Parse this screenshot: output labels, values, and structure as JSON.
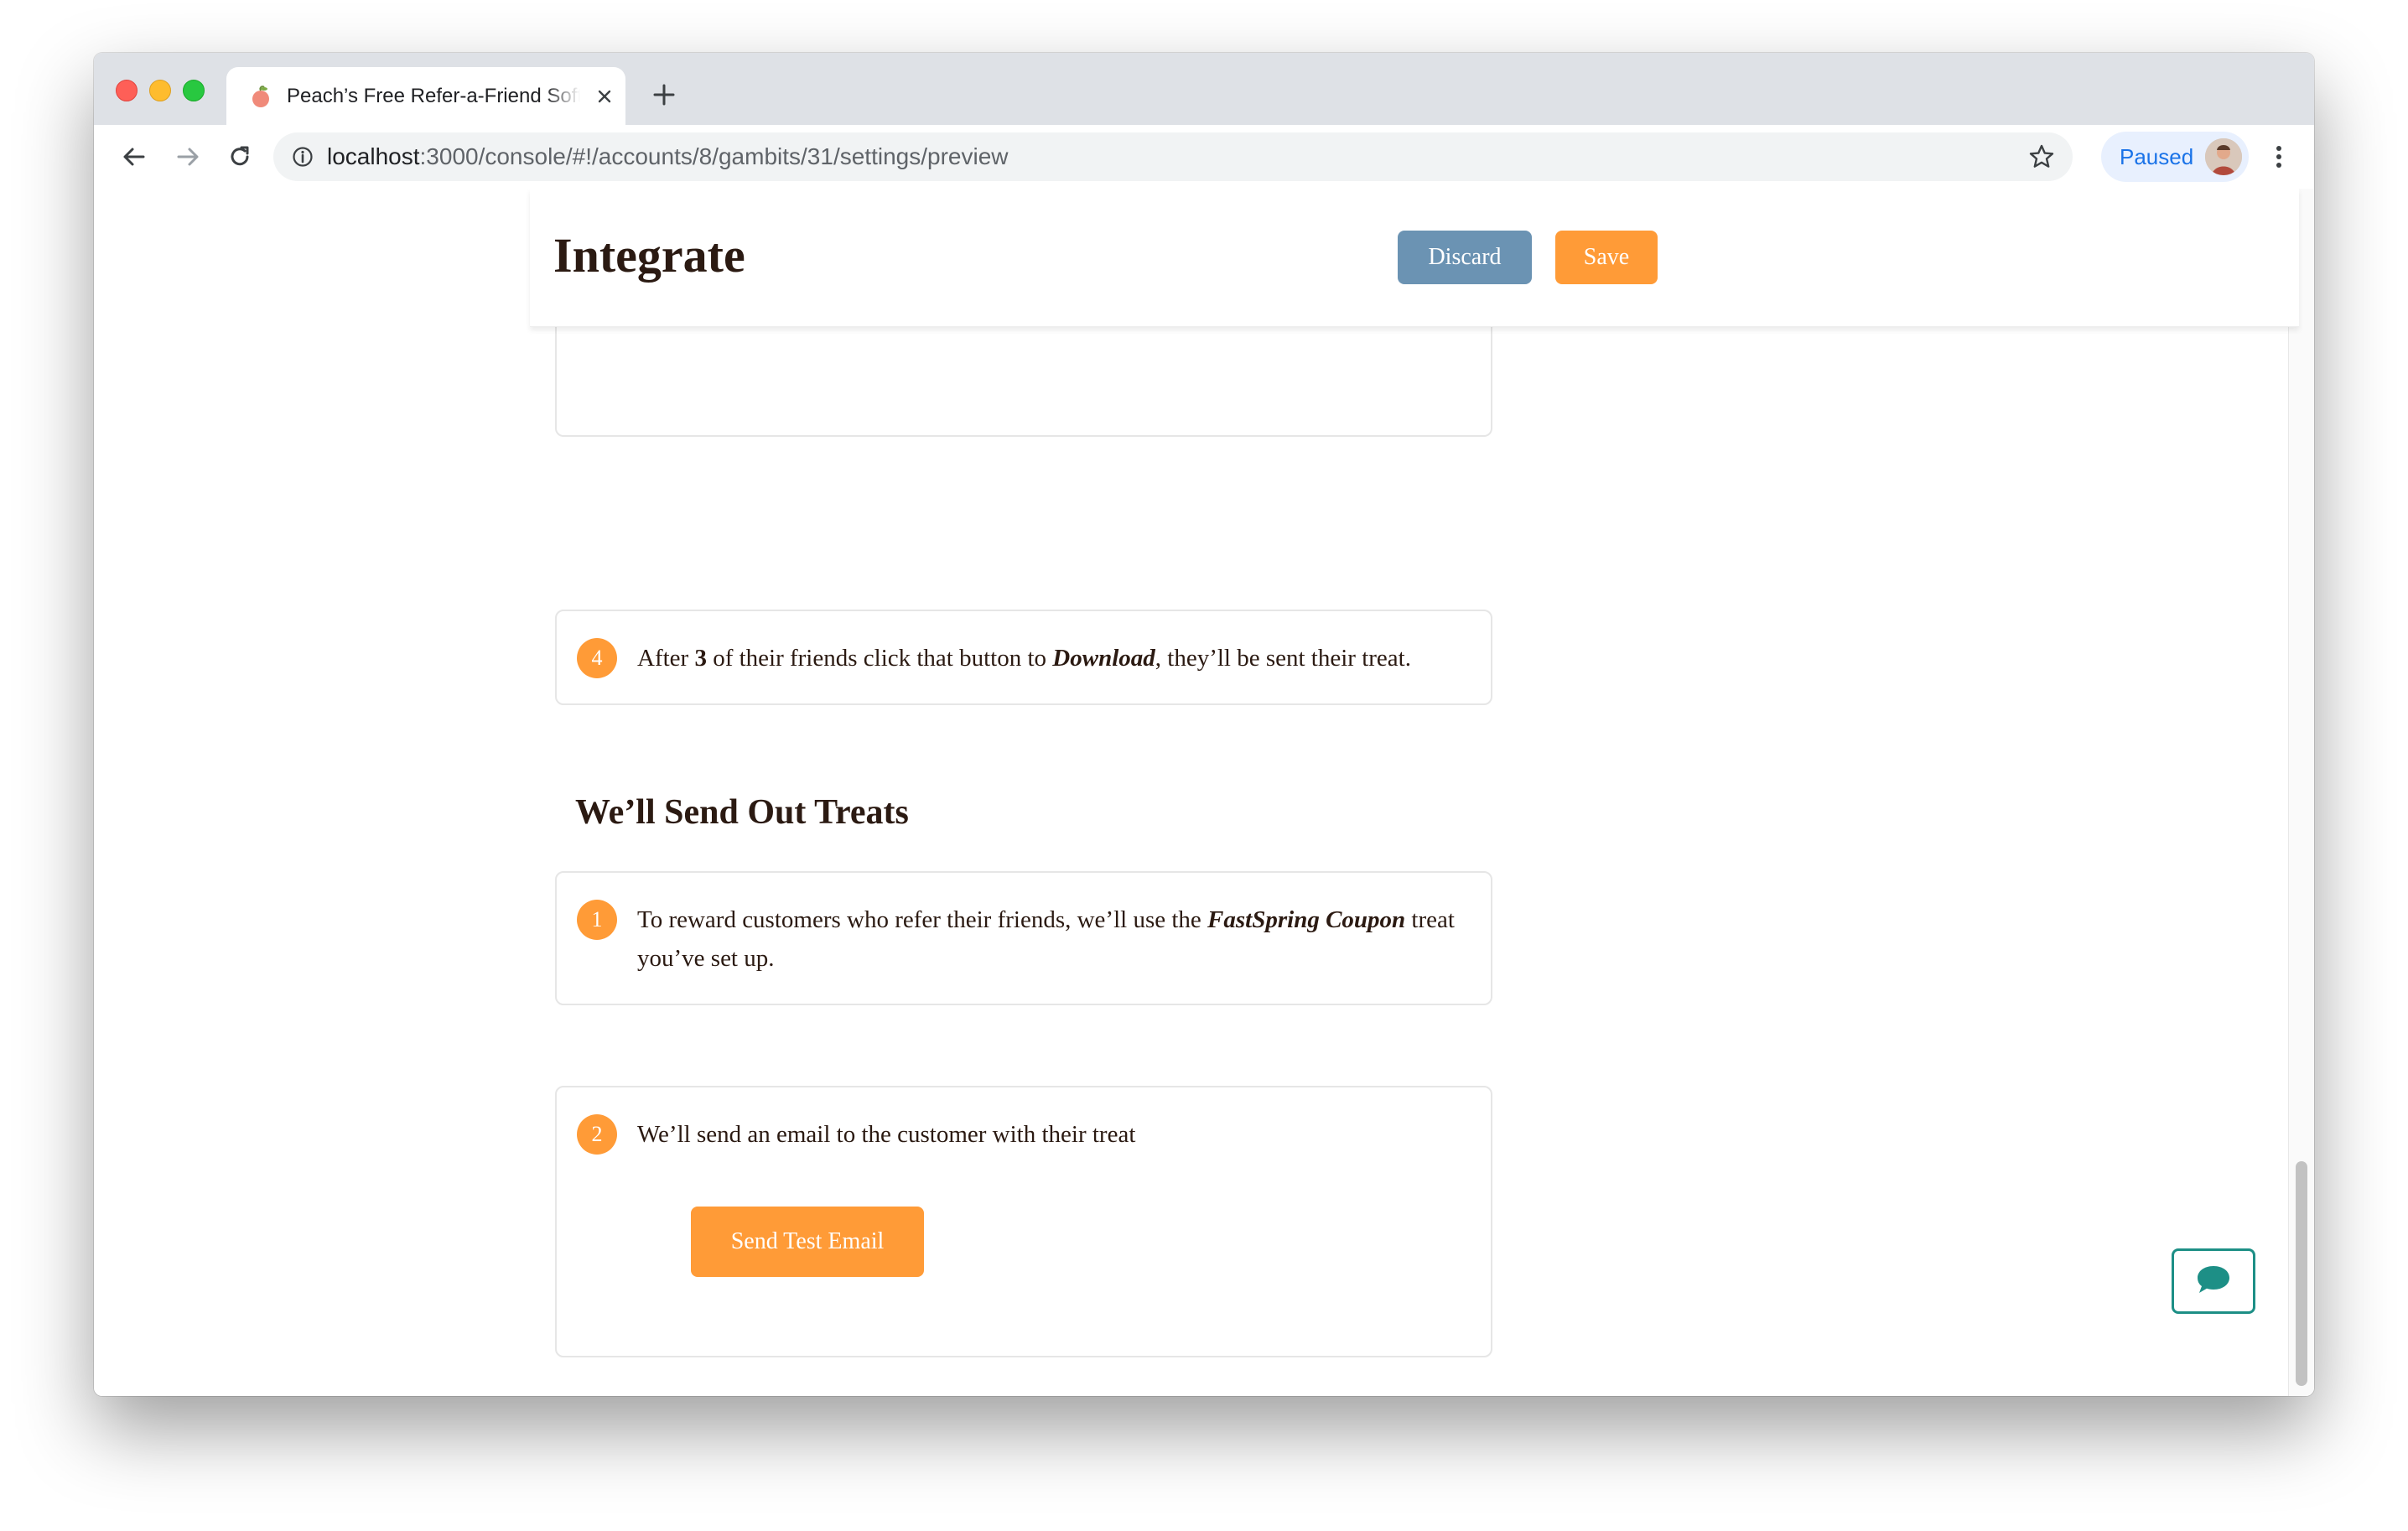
{
  "browser": {
    "tab_title": "Peach’s Free Refer-a-Friend Software",
    "url_host": "localhost",
    "url_rest": ":3000/console/#!/accounts/8/gambits/31/settings/preview",
    "profile_label": "Paused"
  },
  "header": {
    "title": "Integrate",
    "discard_label": "Discard",
    "save_label": "Save"
  },
  "steps_top": [
    {
      "number": "4",
      "text_before": "After ",
      "count": "3",
      "text_mid": " of their friends click that button to ",
      "action": "Download",
      "text_after": ", they’ll be sent their treat."
    }
  ],
  "treats_section": {
    "title": "We’ll Send Out Treats",
    "steps": [
      {
        "number": "1",
        "text_before": "To reward customers who refer their friends, we’ll use the ",
        "treat_name": "FastSpring Coupon",
        "text_after": " treat you’ve set up."
      },
      {
        "number": "2",
        "text": "We’ll send an email to the customer with their treat",
        "button_label": "Send Test Email"
      }
    ]
  },
  "colors": {
    "accent": "#ff9b37",
    "discard": "#6b93b3",
    "chat_border": "#1d8f86",
    "text": "#2b1a12"
  },
  "icons": {
    "favicon": "peach-icon",
    "chat": "chat-bubble-icon"
  }
}
